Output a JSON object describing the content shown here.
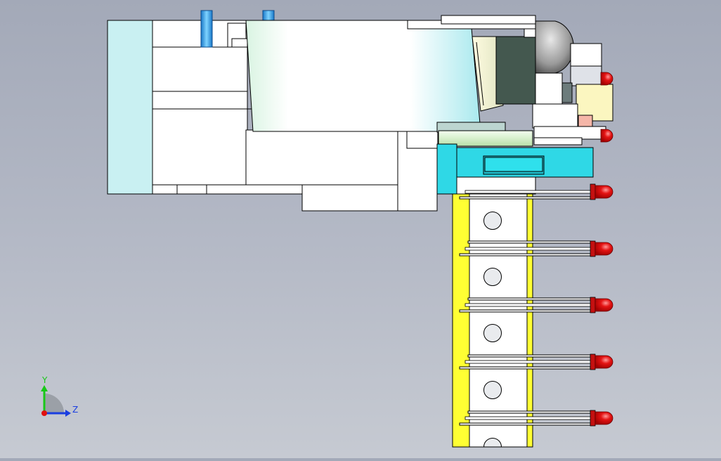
{
  "viewport": {
    "background_top": "#a3a9b8",
    "background_bottom": "#c6cad2",
    "model_kind": "led-strip-fixture-side-view"
  },
  "model": {
    "colors": {
      "edge": "#000000",
      "body": "#ffffff",
      "end_cap": "#c9f0f2",
      "cyan_block": "#2fd8e6",
      "yellow_strip": "#ffff33",
      "dark_green": "#44584f",
      "blue_pin": "#2aa9e8",
      "led_red": "#e01010",
      "light_yellow": "#fbf6c0",
      "pink": "#f5b6a8",
      "dome_gray": "#5a5a5a"
    },
    "strip_holes": 5,
    "led_count": 7
  },
  "triad": {
    "y_label": "Y",
    "z_label": "Z",
    "y_color": "#18c818",
    "z_color": "#1a3ee0",
    "x_color": "#e01010"
  }
}
